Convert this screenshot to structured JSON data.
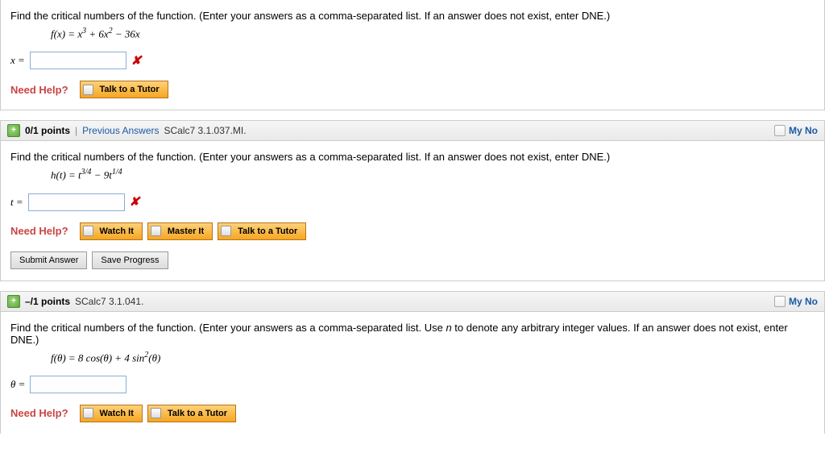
{
  "q1": {
    "prompt": "Find the critical numbers of the function. (Enter your answers as a comma-separated list. If an answer does not exist, enter DNE.)",
    "formula_html": "f(x) = x<span class='sup'>3</span> + 6x<span class='sup'>2</span> − 36x",
    "var_label": "x =",
    "need_help": "Need Help?",
    "talk": "Talk to a Tutor"
  },
  "q2": {
    "points": "0/1 points",
    "prev": "Previous Answers",
    "source": "SCalc7 3.1.037.MI.",
    "my_notes": "My No",
    "prompt": "Find the critical numbers of the function. (Enter your answers as a comma-separated list. If an answer does not exist, enter DNE.)",
    "formula_html": "h(t) = t<span class='sup'>3/4</span> − 9t<span class='sup'>1/4</span>",
    "var_label": "t =",
    "need_help": "Need Help?",
    "watch": "Watch It",
    "master": "Master It",
    "talk": "Talk to a Tutor",
    "submit": "Submit Answer",
    "save": "Save Progress"
  },
  "q3": {
    "points": "–/1 points",
    "source": "SCalc7 3.1.041.",
    "my_notes": "My No",
    "prompt_html": "Find the critical numbers of the function. (Enter your answers as a comma-separated list. Use <i>n</i> to denote any arbitrary integer values. If an answer does not exist, enter DNE.)",
    "formula_html": "f(θ) = 8 cos(θ) + 4 sin<span class='sup'>2</span>(θ)",
    "var_label": "θ =",
    "need_help": "Need Help?",
    "watch": "Watch It",
    "talk": "Talk to a Tutor"
  }
}
